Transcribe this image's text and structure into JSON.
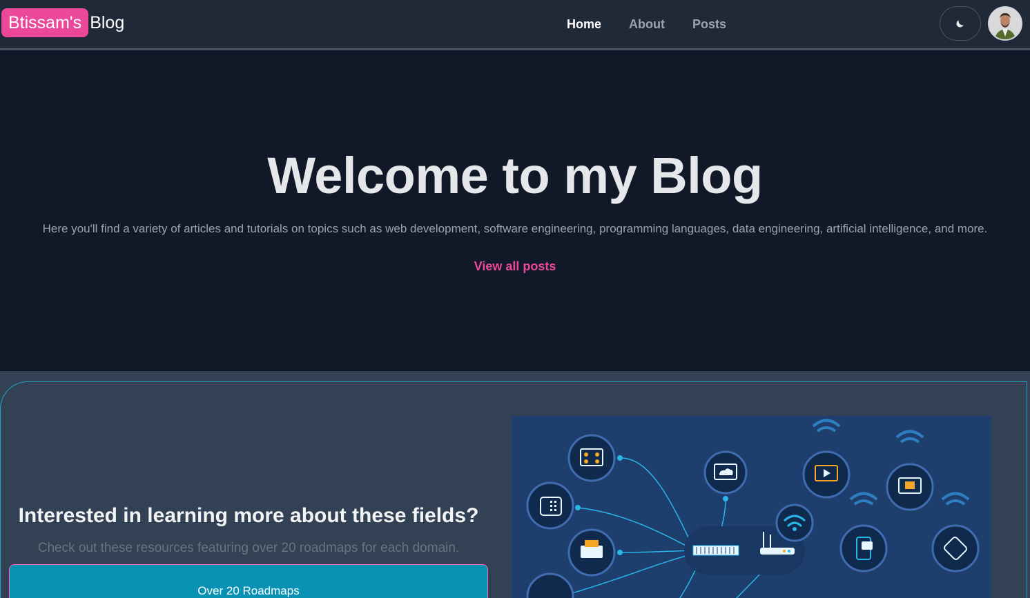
{
  "nav": {
    "brand_highlight": "Btissam's",
    "brand_rest": "Blog",
    "links": [
      {
        "label": "Home"
      },
      {
        "label": "About"
      },
      {
        "label": "Posts"
      }
    ],
    "theme_toggle_icon": "moon-icon",
    "avatar_icon": "user-avatar"
  },
  "hero": {
    "title": "Welcome to my Blog",
    "subtitle": "Here you'll find a variety of articles and tutorials on topics such as web development, software engineering, programming languages, data engineering, artificial intelligence, and more.",
    "cta": "View all posts"
  },
  "roadmaps": {
    "heading": "Interested in learning more about these fields?",
    "text": "Check out these resources featuring over 20 roadmaps for each domain.",
    "button": "Over 20 Roadmaps",
    "image_icon": "network-illustration"
  },
  "colors": {
    "accent_pink": "#ec4899",
    "accent_cyan": "#0891b2",
    "nav_bg": "#1f2937",
    "hero_bg": "#111827",
    "section_bg": "#334155"
  }
}
